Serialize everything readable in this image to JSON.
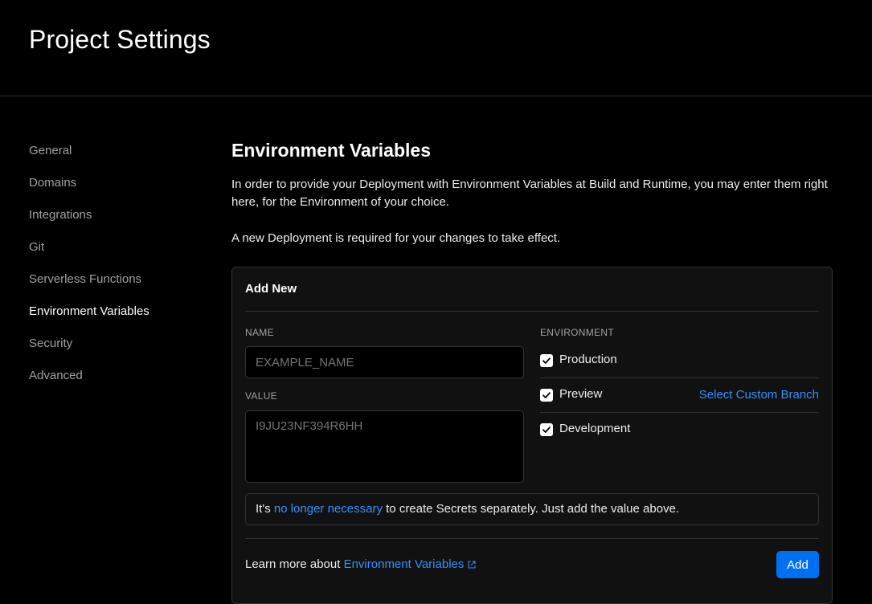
{
  "header": {
    "title": "Project Settings"
  },
  "sidebar": {
    "items": [
      {
        "label": "General"
      },
      {
        "label": "Domains"
      },
      {
        "label": "Integrations"
      },
      {
        "label": "Git"
      },
      {
        "label": "Serverless Functions"
      },
      {
        "label": "Environment Variables",
        "active": true
      },
      {
        "label": "Security"
      },
      {
        "label": "Advanced"
      }
    ]
  },
  "main": {
    "title": "Environment Variables",
    "description": "In order to provide your Deployment with Environment Variables at Build and Runtime, you may enter them right here, for the Environment of your choice.",
    "notice": "A new Deployment is required for your changes to take effect.",
    "card": {
      "title": "Add New",
      "name_label": "NAME",
      "name_placeholder": "EXAMPLE_NAME",
      "value_label": "VALUE",
      "value_placeholder": "I9JU23NF394R6HH",
      "environment_label": "ENVIRONMENT",
      "environments": [
        {
          "label": "Production",
          "checked": true
        },
        {
          "label": "Preview",
          "checked": true
        },
        {
          "label": "Development",
          "checked": true
        }
      ],
      "custom_branch_link": "Select Custom Branch",
      "secrets_notice": {
        "prefix": "It's ",
        "link": "no longer necessary",
        "suffix": " to create Secrets separately. Just add the value above."
      },
      "learn_more": {
        "prefix": "Learn more about ",
        "link": "Environment Variables"
      },
      "add_label": "Add"
    }
  },
  "colors": {
    "background": "#000000",
    "card": "#111111",
    "border": "#333333",
    "link": "#3291ff",
    "primary_button": "#0070f3"
  }
}
